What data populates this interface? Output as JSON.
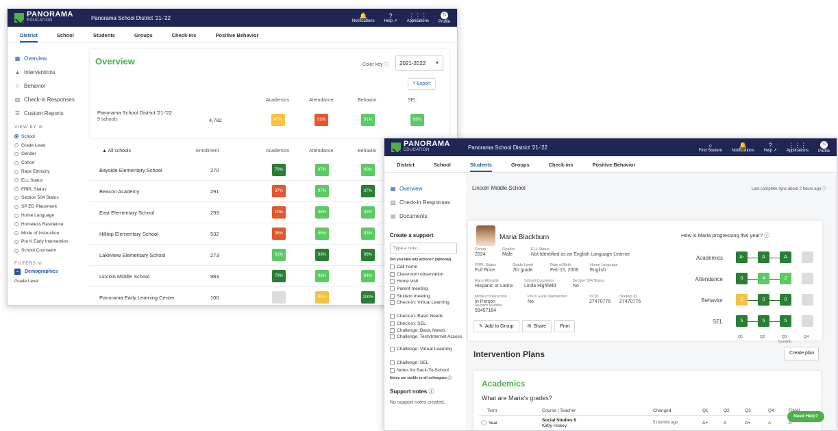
{
  "colors": {
    "nav": "#1f2654",
    "brand_green": "#4db14a",
    "link_blue": "#1f57a5",
    "yellow": "#f5c242",
    "orange": "#e2572d",
    "light_green": "#5bca62",
    "dark_green": "#2a7e35",
    "gray": "#dcdcdc"
  },
  "brand": {
    "name": "PANORAMA",
    "sub": "EDUCATION"
  },
  "w1": {
    "district": "Panorama School District '21-'22",
    "topnav": [
      {
        "label": "Notifications",
        "icon": "bell-icon",
        "glyph": "🔔"
      },
      {
        "label": "Help ↗",
        "icon": "help-icon",
        "glyph": "?"
      },
      {
        "label": "Applications",
        "icon": "grid-icon",
        "glyph": "⋮⋮⋮"
      },
      {
        "label": "Profile",
        "icon": "profile-icon",
        "glyph": "T1"
      }
    ],
    "tabs": [
      "District",
      "School",
      "Students",
      "Groups",
      "Check-ins",
      "Positive Behavior"
    ],
    "sidebar": [
      {
        "label": "Overview",
        "icon": "overview-icon",
        "glyph": "▦"
      },
      {
        "label": "Interventions",
        "icon": "interventions-icon",
        "glyph": "▲"
      },
      {
        "label": "Behavior",
        "icon": "star-icon",
        "glyph": "☆"
      },
      {
        "label": "Check-in Responses",
        "icon": "checkin-icon",
        "glyph": "▥"
      },
      {
        "label": "Custom Reports",
        "icon": "reports-icon",
        "glyph": "☰"
      }
    ],
    "view_by_title": "VIEW BY",
    "view_by": [
      "School",
      "Grade Level",
      "Gender",
      "Cohort",
      "Race Ethnicity",
      "ELL Status",
      "FRPL Status",
      "Section 504 Status",
      "SP ED Placement",
      "Home Language",
      "Homeless Residence",
      "Mode of Instruction",
      "Pre K Early Intervention",
      "School Counselor"
    ],
    "filters_title": "FILTERS",
    "filter_group": "Demographics",
    "filter_sub": "Grade Level",
    "overview_title": "Overview",
    "color_key": "Color key",
    "year_select": "2021-2022",
    "export": "Export",
    "metrics": [
      "Academics",
      "Attendance",
      "Behavior",
      "SEL"
    ],
    "summary": {
      "name": "Panorama School District '21-'22",
      "schools": "9 schools",
      "enrollment": "4,782",
      "cells": [
        {
          "v": "47%",
          "c": "y"
        },
        {
          "v": "92%",
          "c": "o"
        },
        {
          "v": "91%",
          "c": "lg"
        },
        {
          "v": "68%",
          "c": "lg"
        }
      ]
    },
    "table_headers": {
      "name": "All schools",
      "enroll": "Enrollment",
      "a": "Academics",
      "b": "Attendance",
      "c": "Behavior"
    },
    "schools": [
      {
        "name": "Bayside Elementary School",
        "enroll": "270",
        "cells": [
          {
            "v": "79%",
            "c": "dg"
          },
          {
            "v": "97%",
            "c": "lg"
          },
          {
            "v": "90%",
            "c": "lg"
          }
        ]
      },
      {
        "name": "Beacon Academy",
        "enroll": "291",
        "cells": [
          {
            "v": "37%",
            "c": "o"
          },
          {
            "v": "97%",
            "c": "lg"
          },
          {
            "v": "97%",
            "c": "dg"
          }
        ]
      },
      {
        "name": "East Elementary School",
        "enroll": "293",
        "cells": [
          {
            "v": "10%",
            "c": "o"
          },
          {
            "v": "96%",
            "c": "lg"
          },
          {
            "v": "92%",
            "c": "lg"
          }
        ]
      },
      {
        "name": "Hilltop Elementary School",
        "enroll": "532",
        "cells": [
          {
            "v": "36%",
            "c": "o"
          },
          {
            "v": "96%",
            "c": "lg"
          },
          {
            "v": "93%",
            "c": "lg"
          }
        ]
      },
      {
        "name": "Lakeview Elementary School",
        "enroll": "273",
        "cells": [
          {
            "v": "61%",
            "c": "lg"
          },
          {
            "v": "99%",
            "c": "dg"
          },
          {
            "v": "99%",
            "c": "dg"
          }
        ]
      },
      {
        "name": "Lincoln Middle School",
        "enroll": "983",
        "cells": [
          {
            "v": "79%",
            "c": "dg"
          },
          {
            "v": "96%",
            "c": "lg"
          },
          {
            "v": "94%",
            "c": "lg"
          }
        ]
      },
      {
        "name": "Panorama Early Learning Center",
        "enroll": "100",
        "cells": [
          {
            "v": "",
            "c": "g"
          },
          {
            "v": "94%",
            "c": "y"
          },
          {
            "v": "100%",
            "c": "dg"
          }
        ]
      }
    ]
  },
  "w2": {
    "district": "Panorama School District '21-'22",
    "topnav": [
      {
        "label": "Find Student",
        "icon": "search-icon",
        "glyph": "⌕"
      },
      {
        "label": "Notifications",
        "icon": "bell-icon",
        "glyph": "🔔"
      },
      {
        "label": "Help ↗",
        "icon": "help-icon",
        "glyph": "?"
      },
      {
        "label": "Applications",
        "icon": "grid-icon",
        "glyph": "⋮⋮⋮"
      },
      {
        "label": "Profile",
        "icon": "profile-icon",
        "glyph": "T1"
      }
    ],
    "tabs": [
      "District",
      "School",
      "Students",
      "Groups",
      "Check-ins",
      "Positive Behavior"
    ],
    "sidebar": [
      {
        "label": "Overview",
        "icon": "overview-icon",
        "glyph": "▦"
      },
      {
        "label": "Check-in Responses",
        "icon": "checkin-icon",
        "glyph": "▥"
      },
      {
        "label": "Documents",
        "icon": "documents-icon",
        "glyph": "▤"
      }
    ],
    "create_support": "Create a support",
    "note_placeholder": "Type a note...",
    "actions_q": "Did you take any actions? (optional)",
    "actions": [
      "Call home",
      "Classroom observation",
      "Home visit",
      "Parent meeting",
      "Student meeting",
      "Check-in: Virtual Learning",
      "Check-in: Basic Needs",
      "Check-in: SEL",
      "Challenge: Basic Needs",
      "Challenge: Tech/Internet Access",
      "Challenge: Virtual Learning",
      "Challenge: SEL",
      "Notes for Back-To-School"
    ],
    "notes_visible": "Notes are visible to all colleagues",
    "support_notes_title": "Support notes",
    "support_notes_empty": "No support notes created.",
    "school": "Lincoln Middle School",
    "sync": "Last complete sync about 2 hours ago",
    "student_name": "Maria Blackburn",
    "fields": [
      {
        "l": "Cohort",
        "v": "2024"
      },
      {
        "l": "Gender",
        "v": "Male"
      },
      {
        "l": "ELL Status",
        "v": "Not Identified as an English Language Learner"
      },
      {
        "l": "FRPL Status",
        "v": "Full Price"
      },
      {
        "l": "Grade Level",
        "v": "7th grade"
      },
      {
        "l": "Date of Birth",
        "v": "Feb 15, 2006"
      },
      {
        "l": "Home Language",
        "v": "English"
      },
      {
        "l": "Race Ethnicity",
        "v": "Hispanic or Latinx"
      },
      {
        "l": "School Counselor",
        "v": "Linda Highfield"
      },
      {
        "l": "Section 504 Status",
        "v": "No"
      },
      {
        "l": "Mode of Instruction",
        "v": "In Person"
      },
      {
        "l": "Pre K Early Intervention",
        "v": "No"
      },
      {
        "l": "DCID",
        "v": "27470776"
      },
      {
        "l": "Student ID",
        "v": "27470776"
      },
      {
        "l": "Student Number",
        "v": "59457184"
      }
    ],
    "buttons": {
      "add": "Add to Group",
      "share": "Share",
      "print": "Print"
    },
    "progress_title": "How is Maria progressing this year?",
    "progress_rows": [
      {
        "label": "Academics",
        "cells": [
          {
            "v": "A-",
            "c": "dg"
          },
          {
            "v": "A",
            "c": "dg"
          },
          {
            "v": "A",
            "c": "dg"
          },
          {
            "v": "",
            "c": "g"
          }
        ]
      },
      {
        "label": "Attendance",
        "cells": [
          {
            "v": "0",
            "c": "dg"
          },
          {
            "v": "4",
            "c": "lg"
          },
          {
            "v": "2",
            "c": "lg"
          },
          {
            "v": "",
            "c": "g"
          }
        ]
      },
      {
        "label": "Behavior",
        "cells": [
          {
            "v": "2",
            "c": "y"
          },
          {
            "v": "0",
            "c": "dg"
          },
          {
            "v": "0",
            "c": "dg"
          },
          {
            "v": "",
            "c": "g"
          }
        ]
      },
      {
        "label": "SEL",
        "cells": [
          {
            "v": "5",
            "c": "dg"
          },
          {
            "v": "5",
            "c": "dg"
          },
          {
            "v": "5",
            "c": "dg"
          },
          {
            "v": "",
            "c": "g"
          }
        ]
      }
    ],
    "quarters": [
      "Q1",
      "Q2",
      "Q3",
      "Q4"
    ],
    "current": "(current)",
    "interv_title": "Intervention Plans",
    "create_plan": "Create plan",
    "academics": "Academics",
    "grades_q": "What are Maria's grades?",
    "grade_headers": [
      "Term",
      "Course | Teacher",
      "Changed",
      "Q1",
      "Q2",
      "Q3",
      "Q4",
      "FINAL"
    ],
    "grade_row": {
      "term": "Year",
      "course": "Social Studies 6",
      "teacher": "Kirby Hiskey",
      "changed": "5 months ago",
      "q": [
        "A+",
        "A",
        "A+",
        "A",
        "A"
      ]
    },
    "need_help": "Need Help?"
  }
}
